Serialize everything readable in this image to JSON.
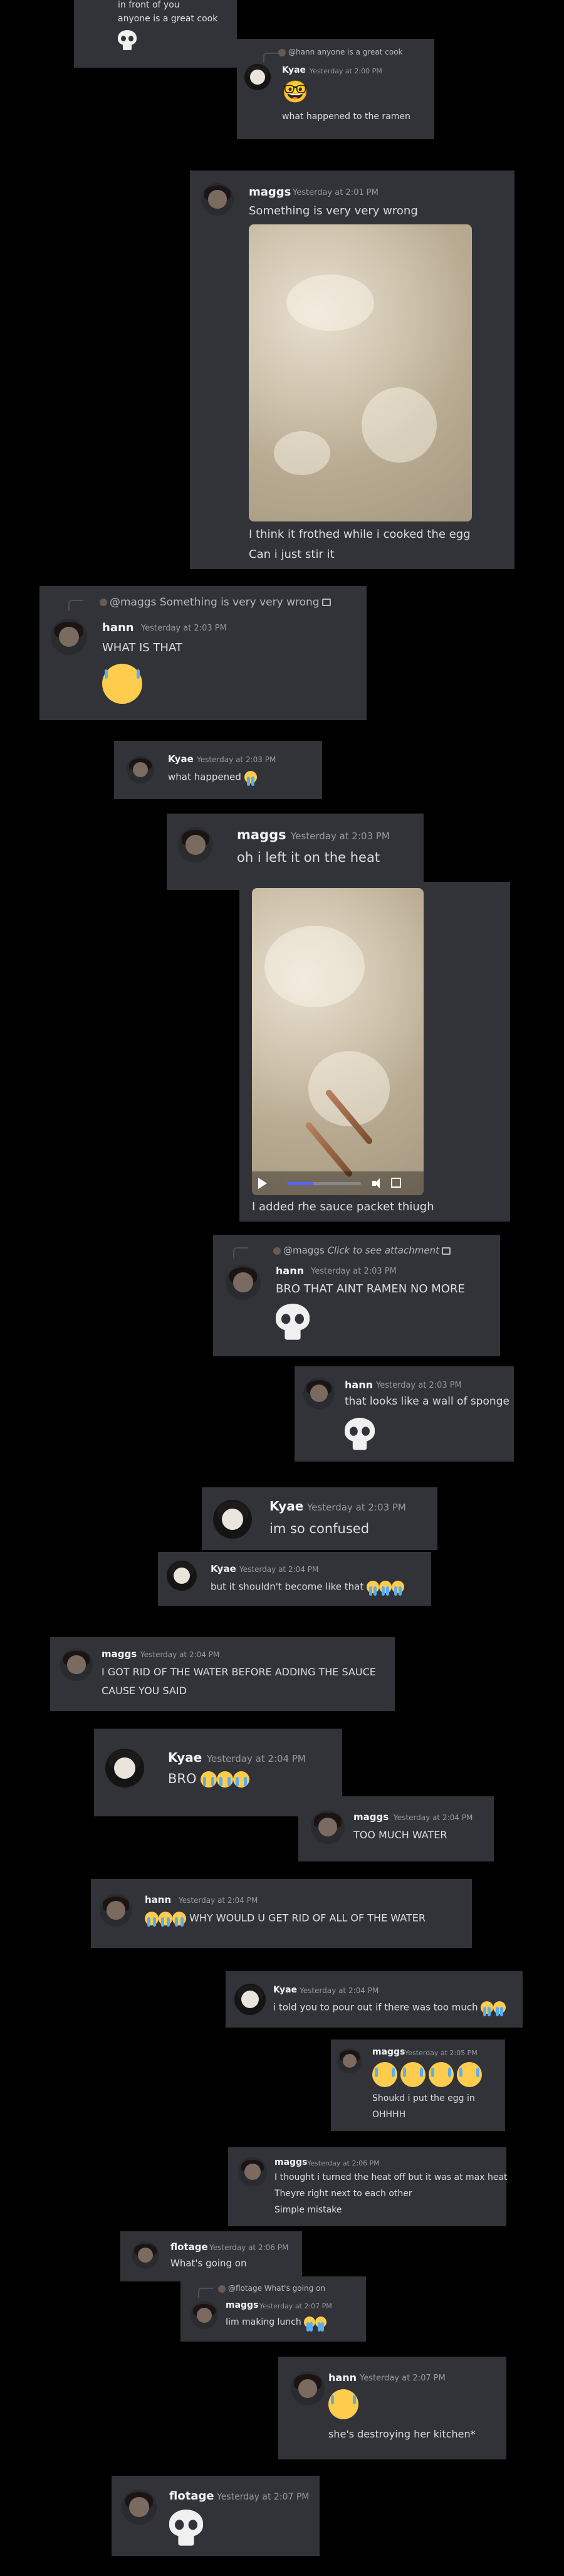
{
  "messages": [
    {
      "id": "m1",
      "text1": "in front of you",
      "text2": "anyone is a great cook"
    },
    {
      "id": "m2",
      "reply": "@hann anyone is a great cook",
      "name": "Kyae",
      "ts": "Yesterday at 2:00 PM",
      "text": "what happened to the ramen",
      "emoji": "🤓"
    },
    {
      "id": "m3",
      "name": "maggs",
      "ts": "Yesterday at 2:01 PM",
      "text": "Something is very very wrong",
      "text2": "I think it frothed while i cooked the egg",
      "text3": "Can i just stir it"
    },
    {
      "id": "m4",
      "reply": "@maggs Something is very very wrong",
      "name": "hann",
      "ts": "Yesterday at 2:03 PM",
      "text": "WHAT IS THAT"
    },
    {
      "id": "m5",
      "name": "Kyae",
      "ts": "Yesterday at 2:03 PM",
      "text": "what happened"
    },
    {
      "id": "m6",
      "name": "maggs",
      "ts": "Yesterday at 2:03 PM",
      "text": "oh i left it on the heat",
      "caption": "I added rhe sauce packet thiugh",
      "video_progress": 0.36
    },
    {
      "id": "m7",
      "reply_name": "@maggs",
      "reply_text": "Click to see attachment",
      "name": "hann",
      "ts": "Yesterday at 2:03 PM",
      "text": "BRO THAT AINT RAMEN NO MORE"
    },
    {
      "id": "m8",
      "name": "hann",
      "ts": "Yesterday at 2:03 PM",
      "text": "that looks like a wall of sponge"
    },
    {
      "id": "m9",
      "name": "Kyae",
      "ts": "Yesterday at 2:03 PM",
      "text": "im so confused"
    },
    {
      "id": "m10",
      "name": "Kyae",
      "ts": "Yesterday at 2:04 PM",
      "text": "but it shouldn't become like that"
    },
    {
      "id": "m11",
      "name": "maggs",
      "ts": "Yesterday at 2:04 PM",
      "text": "I GOT RID OF THE WATER BEFORE ADDING THE SAUCE",
      "text2": "CAUSE YOU SAID"
    },
    {
      "id": "m12",
      "name": "Kyae",
      "ts": "Yesterday at 2:04 PM",
      "text": "BRO"
    },
    {
      "id": "m13",
      "name": "maggs",
      "ts": "Yesterday at 2:04 PM",
      "text": "TOO MUCH WATER"
    },
    {
      "id": "m14",
      "name": "hann",
      "ts": "Yesterday at 2:04 PM",
      "text": "WHY WOULD U GET RID OF ALL OF THE WATER"
    },
    {
      "id": "m15",
      "name": "Kyae",
      "ts": "Yesterday at 2:04 PM",
      "text": "i told you to pour out if there was too much"
    },
    {
      "id": "m16",
      "name": "maggs",
      "ts": "Yesterday at 2:05 PM",
      "text": "Shoukd i put the egg in",
      "text2": "OHHHH"
    },
    {
      "id": "m17",
      "name": "maggs",
      "ts": "Yesterday at 2:06 PM",
      "text": "I thought i turned the heat off but it was at max heat",
      "text2": "Theyre right next to each other",
      "text3": "Simple mistake"
    },
    {
      "id": "m18",
      "name": "flotage",
      "ts": "Yesterday at 2:06 PM",
      "text": "What's going on"
    },
    {
      "id": "m19",
      "reply": "@flotage What's going on",
      "name": "maggs",
      "ts": "Yesterday at 2:07 PM",
      "text": "Iim making lunch"
    },
    {
      "id": "m20",
      "name": "hann",
      "ts": "Yesterday at 2:07 PM",
      "text": "she's destroying her kitchen*"
    },
    {
      "id": "m21",
      "name": "flotage",
      "ts": "Yesterday at 2:07 PM"
    }
  ]
}
